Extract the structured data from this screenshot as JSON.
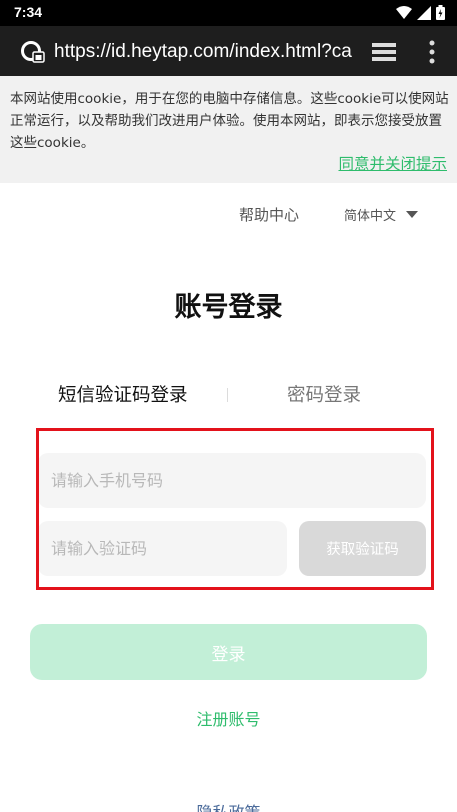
{
  "status_bar": {
    "time": "7:34",
    "icons": [
      "wifi-icon",
      "signal-icon",
      "battery-icon"
    ]
  },
  "browser": {
    "url": "https://id.heytap.com/index.html?callback",
    "icons": [
      "site-info-icon",
      "tabs-icon",
      "menu-dots-icon"
    ]
  },
  "cookie_banner": {
    "text": "本网站使用cookie，用于在您的电脑中存储信息。这些cookie可以使网站正常运行，以及帮助我们改进用户体验。使用本网站，即表示您接受放置这些cookie。",
    "accept_link": "同意并关闭提示"
  },
  "header": {
    "help_label": "帮助中心",
    "language_label": "简体中文"
  },
  "main": {
    "title": "账号登录",
    "tabs": [
      {
        "label": "短信验证码登录",
        "active": true
      },
      {
        "label": "密码登录",
        "active": false
      }
    ],
    "phone_placeholder": "请输入手机号码",
    "code_placeholder": "请输入验证码",
    "get_code_label": "获取验证码",
    "login_label": "登录",
    "register_label": "注册账号",
    "privacy_label": "隐私政策"
  },
  "colors": {
    "brand_green": "#2ebc6c",
    "login_button_disabled": "#c2efd7",
    "highlight_red": "#e3121b"
  }
}
